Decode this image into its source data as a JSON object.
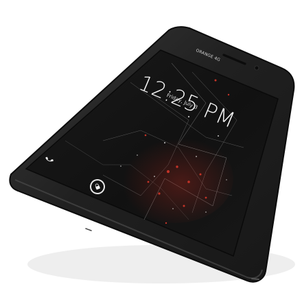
{
  "screen": {
    "carrier": "ORANGE 4G",
    "time": "12:25 PM",
    "date": "Friday, July 3"
  },
  "icons": {
    "phone": "phone-icon",
    "lock": "lock-icon",
    "camera": "front-camera-icon",
    "speaker": "earpiece-speaker-icon"
  },
  "colors": {
    "body": "#1f1f1f",
    "bezel": "#0f0f0f",
    "screen_bg": "#151515",
    "accent_red": "#b0291e"
  }
}
